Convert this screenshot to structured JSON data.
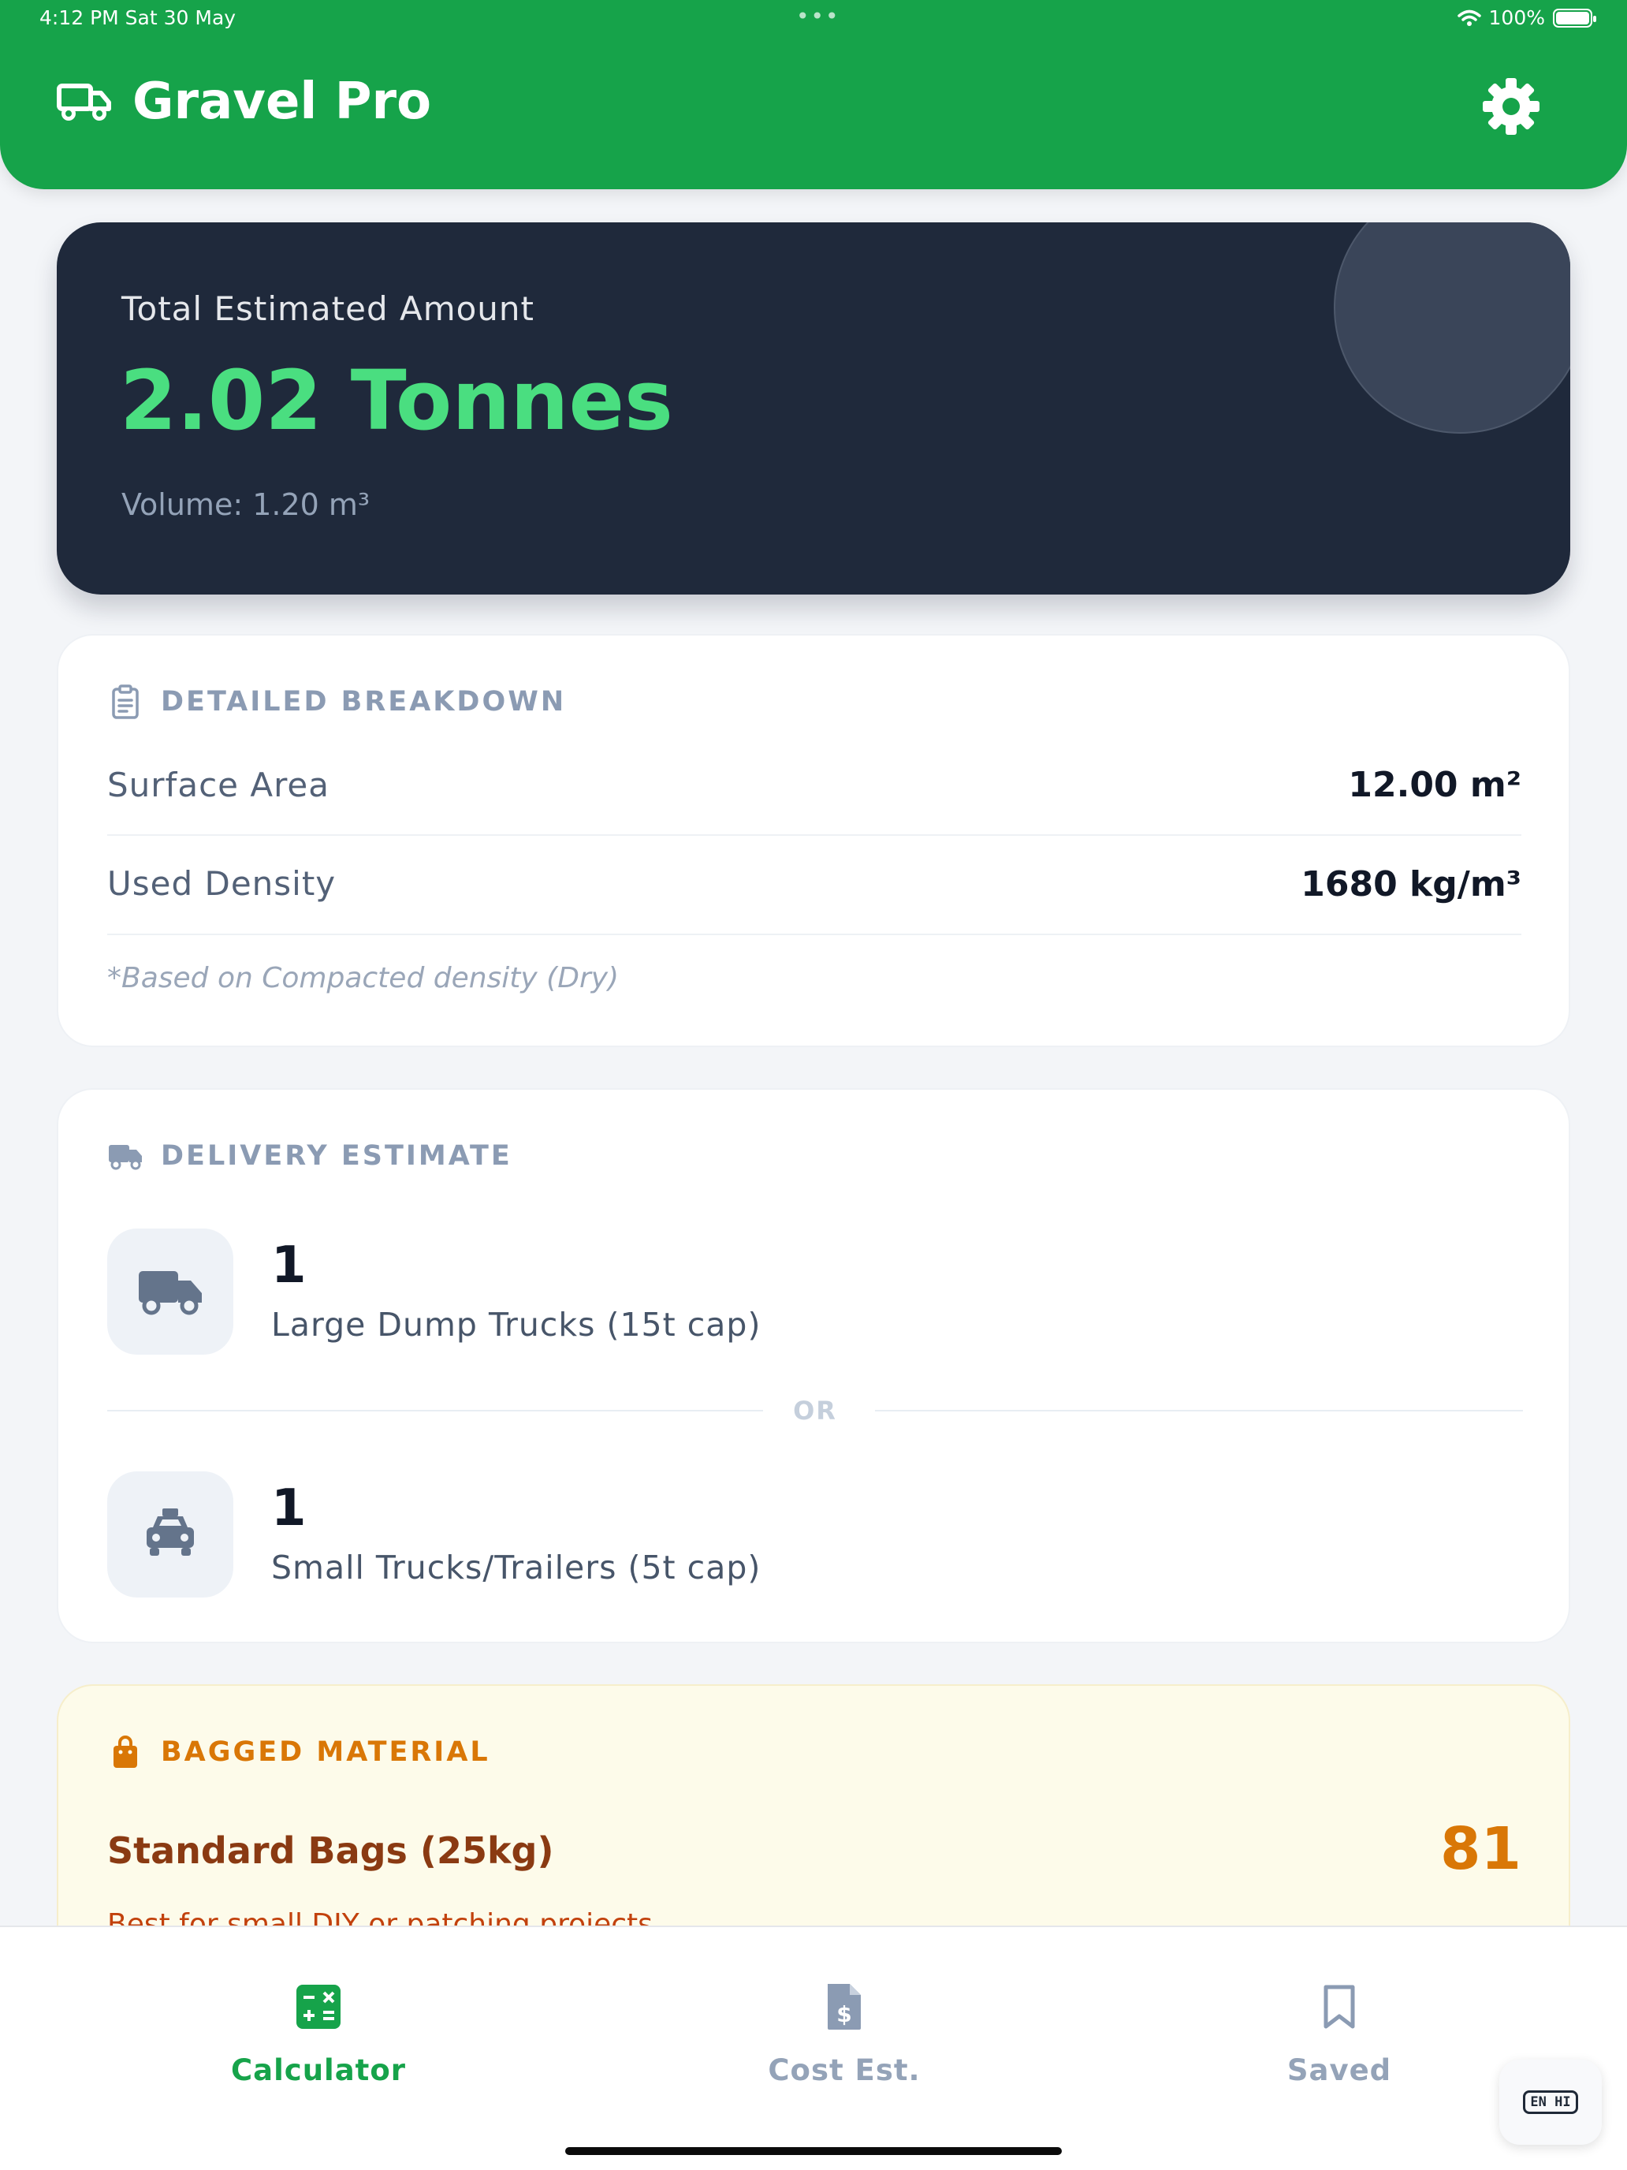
{
  "status_bar": {
    "time": "4:12 PM   Sat 30 May",
    "battery": "100%"
  },
  "header": {
    "title": "Gravel Pro",
    "icons": {
      "brand": "truck-icon",
      "settings": "gear-icon"
    }
  },
  "summary": {
    "label": "Total Estimated Amount",
    "value": "2.02 Tonnes",
    "volume": "Volume: 1.20 m³"
  },
  "breakdown": {
    "title": "DETAILED BREAKDOWN",
    "icon": "clipboard-icon",
    "rows": [
      {
        "label": "Surface Area",
        "value": "12.00 m²"
      },
      {
        "label": "Used Density",
        "value": "1680 kg/m³"
      }
    ],
    "note": "*Based on Compacted density (Dry)"
  },
  "delivery": {
    "title": "DELIVERY ESTIMATE",
    "icon": "truck-icon",
    "large": {
      "count": "1",
      "label": "Large Dump Trucks (15t cap)",
      "icon": "dump-truck-icon"
    },
    "separator": "OR",
    "small": {
      "count": "1",
      "label": "Small Trucks/Trailers (5t cap)",
      "icon": "car-icon"
    }
  },
  "bagged": {
    "title": "BAGGED MATERIAL",
    "icon": "shopping-bag-icon",
    "item_name": "Standard Bags (25kg)",
    "count": "81",
    "hint": "Best for small DIY or patching projects"
  },
  "tabs": [
    {
      "label": "Calculator",
      "icon": "calculator-icon",
      "active": true
    },
    {
      "label": "Cost Est.",
      "icon": "invoice-dollar-icon",
      "active": false
    },
    {
      "label": "Saved",
      "icon": "bookmark-icon",
      "active": false
    }
  ],
  "language_toggle": {
    "label": "EN HI"
  },
  "colors": {
    "primary": "#16a34a",
    "hero_bg": "#1f293b",
    "hero_value": "#4ade80",
    "bag_accent": "#d97706",
    "bag_bg": "#fdfbea"
  }
}
